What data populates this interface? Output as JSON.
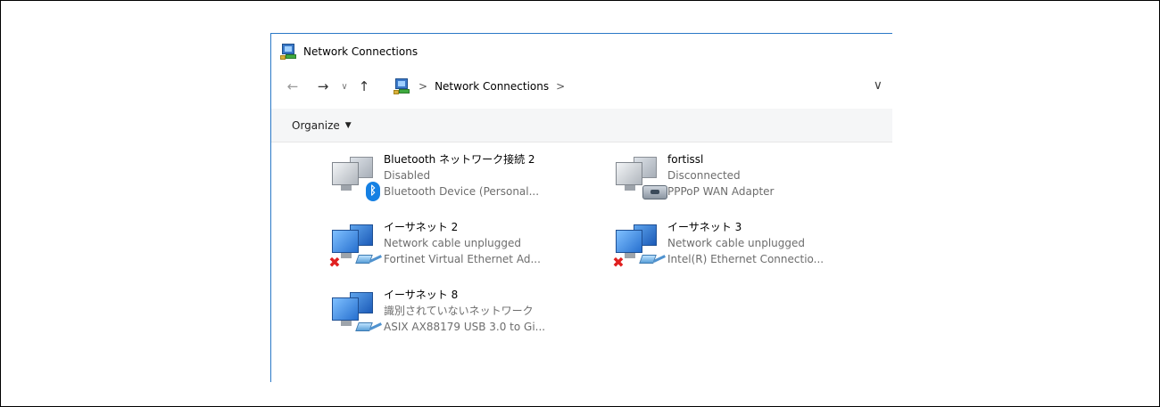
{
  "window": {
    "title": "Network Connections"
  },
  "addressbar": {
    "breadcrumb": "Network Connections",
    "separator": ">",
    "dropdown_glyph": "∨"
  },
  "toolbar": {
    "organize_label": "Organize",
    "organize_caret": "▼"
  },
  "connections": [
    {
      "name": "Bluetooth ネットワーク接続 2",
      "status": "Disabled",
      "device": "Bluetooth Device (Personal...",
      "icon": "bluetooth-adapter-icon"
    },
    {
      "name": "fortissl",
      "status": "Disconnected",
      "device": "PPPoP WAN Adapter",
      "icon": "dialup-adapter-icon"
    },
    {
      "name": "イーサネット 2",
      "status": "Network cable unplugged",
      "device": "Fortinet Virtual Ethernet Ad...",
      "icon": "ethernet-unplugged-icon"
    },
    {
      "name": "イーサネット 3",
      "status": "Network cable unplugged",
      "device": "Intel(R) Ethernet Connectio...",
      "icon": "ethernet-unplugged-icon"
    },
    {
      "name": "イーサネット 8",
      "status": "識別されていないネットワーク",
      "device": "ASIX AX88179 USB 3.0 to Gi...",
      "icon": "ethernet-connected-icon"
    }
  ],
  "colors": {
    "window_border": "#2b79c7",
    "toolbar_bg": "#f5f6f7",
    "secondary_text": "#6d6d6d",
    "error_red": "#e02020"
  }
}
